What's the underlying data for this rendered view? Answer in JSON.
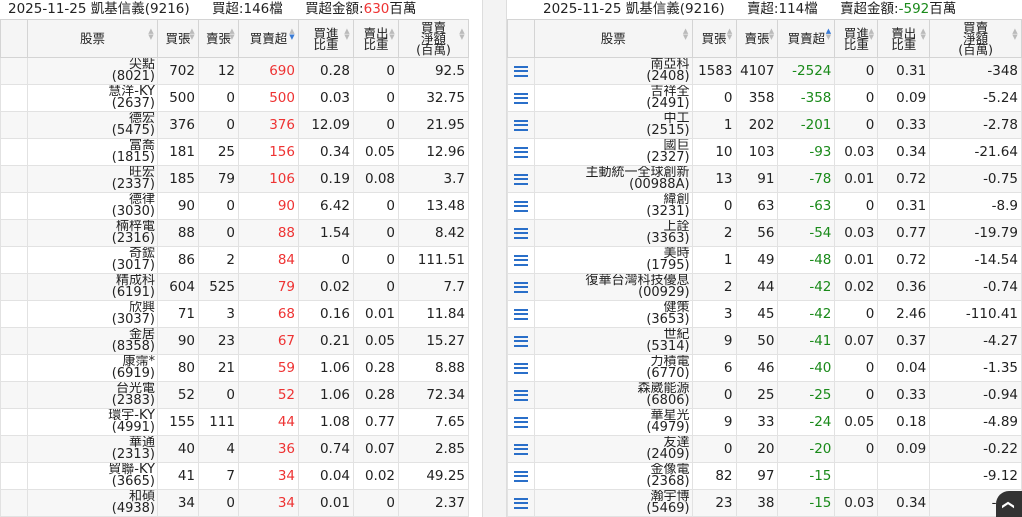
{
  "left": {
    "summary": {
      "date_broker": "2025-11-25 凱基信義(9216)",
      "count_label": "買超:146檔",
      "amount_prefix": "買超金額:",
      "amount_value": "630",
      "amount_unit": "百萬"
    },
    "headers": [
      "股票",
      "買張",
      "賣張",
      "買賣超",
      "買進|比重",
      "賣出|比重",
      "買賣|淨額|(百萬)"
    ],
    "rows": [
      [
        "尖點",
        "(8021)",
        "702",
        "12",
        "690",
        "0.28",
        "0",
        "92.5"
      ],
      [
        "慧洋-KY",
        "(2637)",
        "500",
        "0",
        "500",
        "0.03",
        "0",
        "32.75"
      ],
      [
        "德宏",
        "(5475)",
        "376",
        "0",
        "376",
        "12.09",
        "0",
        "21.95"
      ],
      [
        "富喬",
        "(1815)",
        "181",
        "25",
        "156",
        "0.34",
        "0.05",
        "12.96"
      ],
      [
        "旺宏",
        "(2337)",
        "185",
        "79",
        "106",
        "0.19",
        "0.08",
        "3.7"
      ],
      [
        "德律",
        "(3030)",
        "90",
        "0",
        "90",
        "6.42",
        "0",
        "13.48"
      ],
      [
        "楠梓電",
        "(2316)",
        "88",
        "0",
        "88",
        "1.54",
        "0",
        "8.42"
      ],
      [
        "奇鋐",
        "(3017)",
        "86",
        "2",
        "84",
        "0",
        "0",
        "111.51"
      ],
      [
        "精成科",
        "(6191)",
        "604",
        "525",
        "79",
        "0.02",
        "0",
        "7.7"
      ],
      [
        "欣興",
        "(3037)",
        "71",
        "3",
        "68",
        "0.16",
        "0.01",
        "11.84"
      ],
      [
        "金居",
        "(8358)",
        "90",
        "23",
        "67",
        "0.21",
        "0.05",
        "15.27"
      ],
      [
        "康霈*",
        "(6919)",
        "80",
        "21",
        "59",
        "1.06",
        "0.28",
        "8.88"
      ],
      [
        "台光電",
        "(2383)",
        "52",
        "0",
        "52",
        "1.06",
        "0.28",
        "72.34"
      ],
      [
        "環宇-KY",
        "(4991)",
        "155",
        "111",
        "44",
        "1.08",
        "0.77",
        "7.65"
      ],
      [
        "華通",
        "(2313)",
        "40",
        "4",
        "36",
        "0.74",
        "0.07",
        "2.85"
      ],
      [
        "貿聯-KY",
        "(3665)",
        "41",
        "7",
        "34",
        "0.04",
        "0.02",
        "49.25"
      ],
      [
        "和碩",
        "(4938)",
        "34",
        "0",
        "34",
        "0.01",
        "0",
        "2.37"
      ]
    ]
  },
  "right": {
    "summary": {
      "date_broker": "2025-11-25 凱基信義(9216)",
      "count_label": "賣超:114檔",
      "amount_prefix": "賣超金額:",
      "amount_value": "-592",
      "amount_unit": "百萬"
    },
    "headers": [
      "股票",
      "買張",
      "賣張",
      "買賣超",
      "買進|比重",
      "賣出|比重",
      "買賣|淨額|(百萬)"
    ],
    "rows": [
      [
        "南亞科",
        "(2408)",
        "1583",
        "4107",
        "-2524",
        "0",
        "0.31",
        "-348"
      ],
      [
        "吉祥全",
        "(2491)",
        "0",
        "358",
        "-358",
        "0",
        "0.09",
        "-5.24"
      ],
      [
        "中工",
        "(2515)",
        "1",
        "202",
        "-201",
        "0",
        "0.33",
        "-2.78"
      ],
      [
        "國巨",
        "(2327)",
        "10",
        "103",
        "-93",
        "0.03",
        "0.34",
        "-21.64"
      ],
      [
        "主動統一全球創新",
        "(00988A)",
        "13",
        "91",
        "-78",
        "0.01",
        "0.72",
        "-0.75"
      ],
      [
        "緯創",
        "(3231)",
        "0",
        "63",
        "-63",
        "0",
        "0.31",
        "-8.9"
      ],
      [
        "上詮",
        "(3363)",
        "2",
        "56",
        "-54",
        "0.03",
        "0.77",
        "-19.79"
      ],
      [
        "美時",
        "(1795)",
        "1",
        "49",
        "-48",
        "0.01",
        "0.72",
        "-14.54"
      ],
      [
        "復華台灣科技優息",
        "(00929)",
        "2",
        "44",
        "-42",
        "0.02",
        "0.36",
        "-0.74"
      ],
      [
        "健策",
        "(3653)",
        "3",
        "45",
        "-42",
        "0",
        "2.46",
        "-110.41"
      ],
      [
        "世紀",
        "(5314)",
        "9",
        "50",
        "-41",
        "0.07",
        "0.37",
        "-4.27"
      ],
      [
        "力積電",
        "(6770)",
        "6",
        "46",
        "-40",
        "0",
        "0.04",
        "-1.35"
      ],
      [
        "森崴能源",
        "(6806)",
        "0",
        "25",
        "-25",
        "0",
        "0.33",
        "-0.94"
      ],
      [
        "華星光",
        "(4979)",
        "9",
        "33",
        "-24",
        "0.05",
        "0.18",
        "-4.89"
      ],
      [
        "友達",
        "(2409)",
        "0",
        "20",
        "-20",
        "0",
        "0.09",
        "-0.22"
      ],
      [
        "金像電",
        "(2368)",
        "82",
        "97",
        "-15",
        "",
        "",
        "-9.12"
      ],
      [
        "瀚宇博",
        "(5469)",
        "23",
        "38",
        "-15",
        "0.03",
        "0.34",
        "-1.4"
      ]
    ]
  },
  "icons": {
    "row_list": "list-icon",
    "scroll_top": "chevron-up-icon"
  },
  "colors": {
    "positive": "#e33333",
    "negative": "#1a8a1a",
    "accent": "#2a6fc9"
  }
}
